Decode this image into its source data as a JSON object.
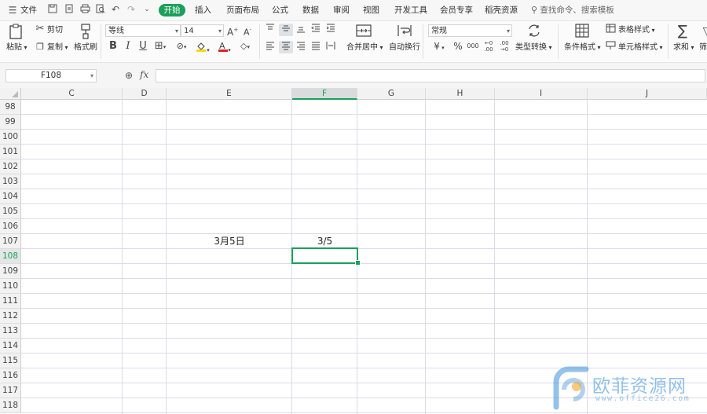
{
  "menu": {
    "file": "文件",
    "tabs": [
      "开始",
      "插入",
      "页面布局",
      "公式",
      "数据",
      "审阅",
      "视图",
      "开发工具",
      "会员专享",
      "稻壳资源"
    ],
    "active_tab": "开始",
    "search_placeholder": "查找命令、搜索模板"
  },
  "ribbon": {
    "paste": "粘贴",
    "cut": "剪切",
    "copy": "复制",
    "format_painter": "格式刷",
    "font_name": "等线",
    "font_size": "14",
    "number_format": "常规",
    "merge_center": "合并居中",
    "wrap_text": "自动换行",
    "type_convert": "类型转换",
    "conditional_format": "条件格式",
    "table_style": "表格样式",
    "cell_style": "单元格样式",
    "sum": "求和",
    "filter": "筛"
  },
  "formula_bar": {
    "name_box": "F108",
    "fx": "fx",
    "content": ""
  },
  "grid": {
    "columns": [
      "C",
      "D",
      "E",
      "F",
      "G",
      "H",
      "I",
      "J"
    ],
    "selected_column": "F",
    "rows": [
      "98",
      "99",
      "100",
      "101",
      "102",
      "103",
      "104",
      "105",
      "106",
      "107",
      "108",
      "109",
      "110",
      "111",
      "112",
      "113",
      "114",
      "115",
      "116",
      "117",
      "118"
    ],
    "selected_row": "108",
    "cells": {
      "E107": "3月5日",
      "F107": "3/5"
    },
    "selected_cell": "F108"
  },
  "watermark": {
    "name": "欧菲资源网",
    "url": "www.office26.com"
  },
  "colors": {
    "accent": "#1aa05b",
    "grid_line": "#dbdbea",
    "watermark_blue": "#3b8fd8",
    "watermark_orange": "#f5a623"
  }
}
